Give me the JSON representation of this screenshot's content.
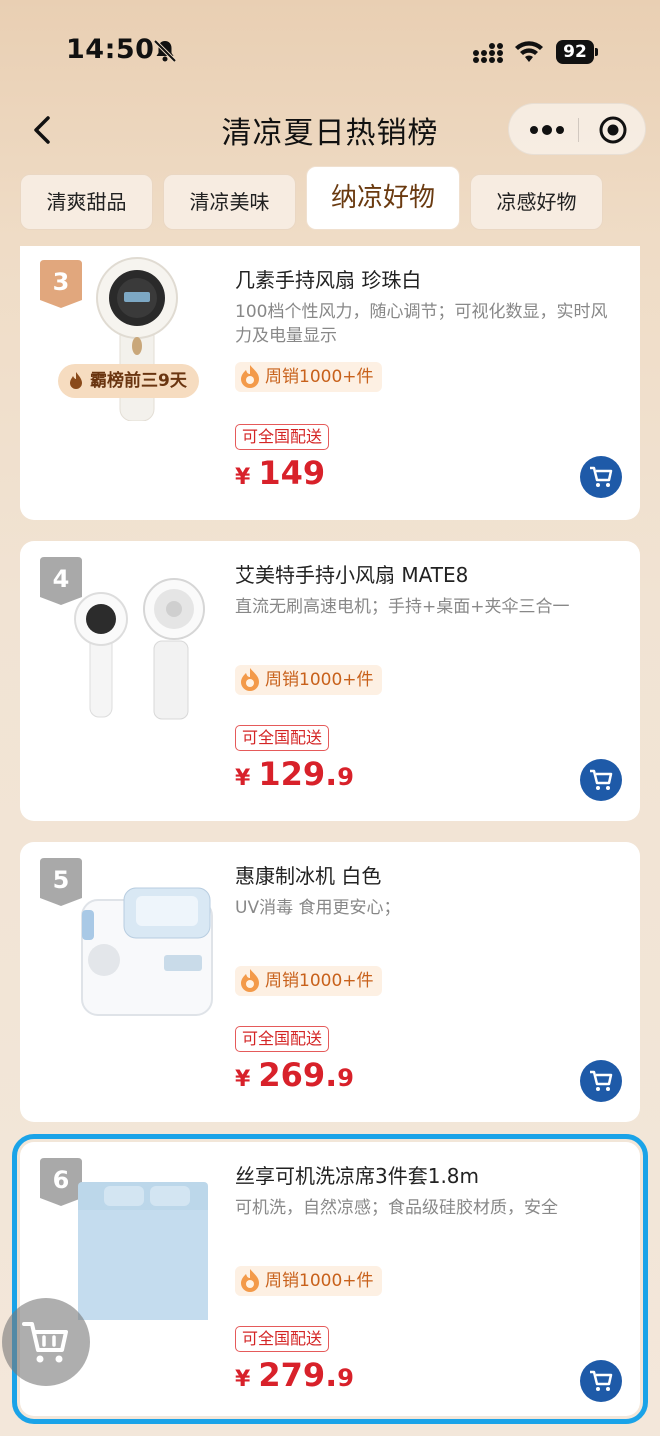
{
  "status_bar": {
    "time": "14:50",
    "battery": "92"
  },
  "nav": {
    "title": "清凉夏日热销榜"
  },
  "tabs": [
    {
      "label": "清爽甜品",
      "active": false
    },
    {
      "label": "清凉美味",
      "active": false
    },
    {
      "label": "纳凉好物",
      "active": true
    },
    {
      "label": "凉感好物",
      "active": false
    }
  ],
  "products": [
    {
      "rank": "3",
      "name": "几素手持风扇 珍珠白",
      "desc": "100档个性风力，随心调节；可视化数显，实时风力及电量显示",
      "sales": "周销1000+件",
      "shipping": "可全国配送",
      "currency": "¥",
      "price_int": "149",
      "price_dec": "",
      "badge": "霸榜前三9天"
    },
    {
      "rank": "4",
      "name": "艾美特手持小风扇 MATE8",
      "desc": "直流无刷高速电机；手持+桌面+夹伞三合一",
      "sales": "周销1000+件",
      "shipping": "可全国配送",
      "currency": "¥",
      "price_int": "129.",
      "price_dec": "9"
    },
    {
      "rank": "5",
      "name": "惠康制冰机 白色",
      "desc": "UV消毒 食用更安心；",
      "sales": "周销1000+件",
      "shipping": "可全国配送",
      "currency": "¥",
      "price_int": "269.",
      "price_dec": "9"
    },
    {
      "rank": "6",
      "name": "丝享可机洗凉席3件套1.8m",
      "desc": "可机洗，自然凉感；食品级硅胶材质，安全",
      "sales": "周销1000+件",
      "shipping": "可全国配送",
      "currency": "¥",
      "price_int": "279.",
      "price_dec": "9"
    }
  ],
  "colors": {
    "accent_price": "#d8212a",
    "cart_button": "#1e5aa8",
    "highlight": "#1aa3e8",
    "rank_top3": "#e1a77d",
    "rank_other": "#a9a9a9"
  },
  "icons": {
    "back": "chevron-left-icon",
    "more": "more-dots-icon",
    "close": "target-circle-icon",
    "cart": "shopping-cart-icon",
    "flame": "flame-icon"
  }
}
